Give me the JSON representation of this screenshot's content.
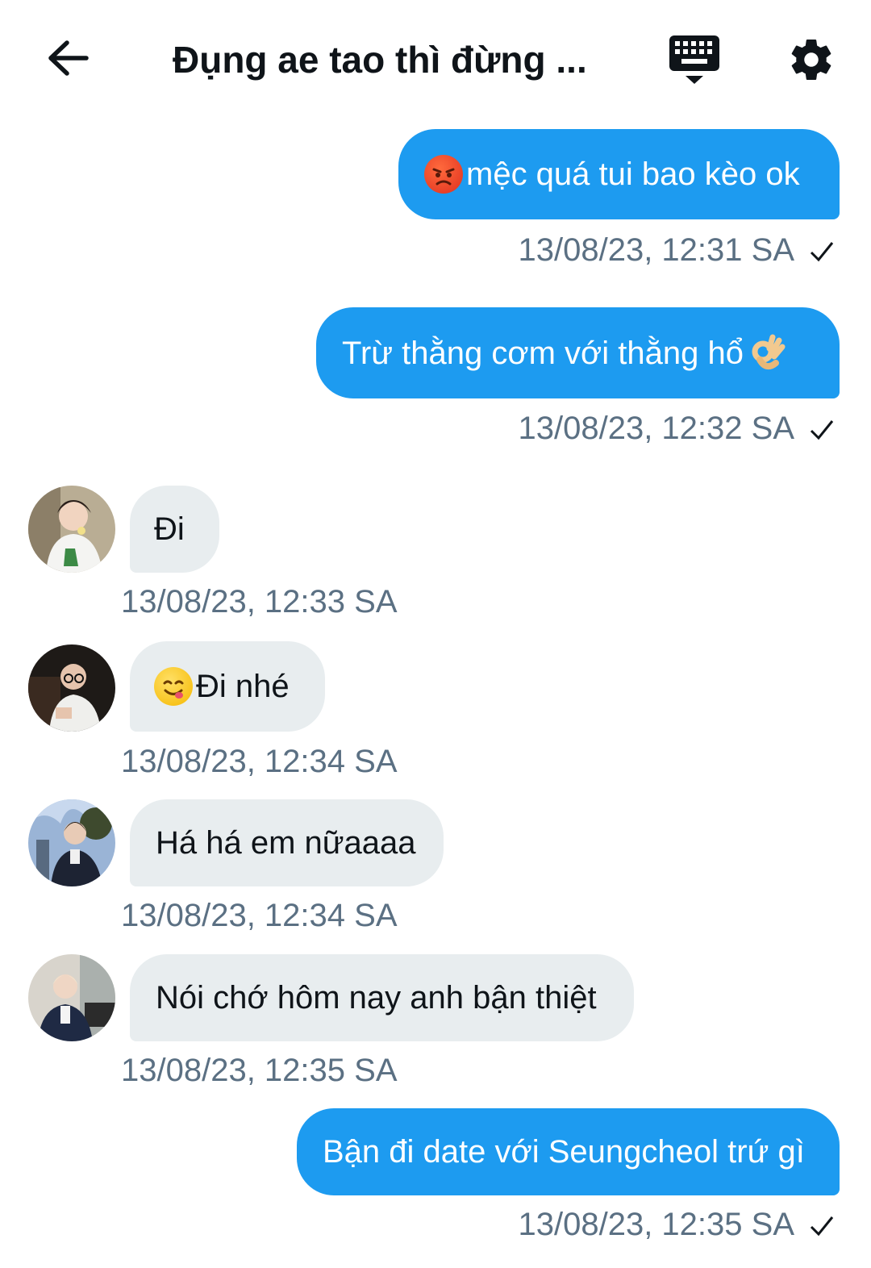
{
  "header": {
    "title": "Đụng ae tao thì đừng ..."
  },
  "messages": [
    {
      "direction": "out",
      "text": "mệc quá tui bao kèo ok",
      "emoji": "angry-face",
      "timestamp": "13/08/23, 12:31 SA"
    },
    {
      "direction": "out",
      "text": "Trừ thằng cơm với thằng hổ ",
      "emoji": "ok-hand",
      "timestamp": "13/08/23, 12:32 SA"
    },
    {
      "direction": "in",
      "text": "Đi",
      "timestamp": "13/08/23, 12:33 SA"
    },
    {
      "direction": "in",
      "text": "Đi nhé",
      "emoji": "yum-face",
      "timestamp": "13/08/23, 12:34 SA"
    },
    {
      "direction": "in",
      "text": "Há há em nữaaaa",
      "timestamp": "13/08/23, 12:34 SA"
    },
    {
      "direction": "in",
      "text": "Nói chớ hôm nay anh bận thiệt",
      "timestamp": "13/08/23, 12:35 SA"
    },
    {
      "direction": "out",
      "text": "Bận đi date với Seungcheol trứ gì",
      "timestamp": "13/08/23, 12:35 SA"
    }
  ],
  "colors": {
    "outgoing_bubble": "#1d9bf0",
    "incoming_bubble": "#e8edef",
    "timestamp": "#5b7083"
  }
}
